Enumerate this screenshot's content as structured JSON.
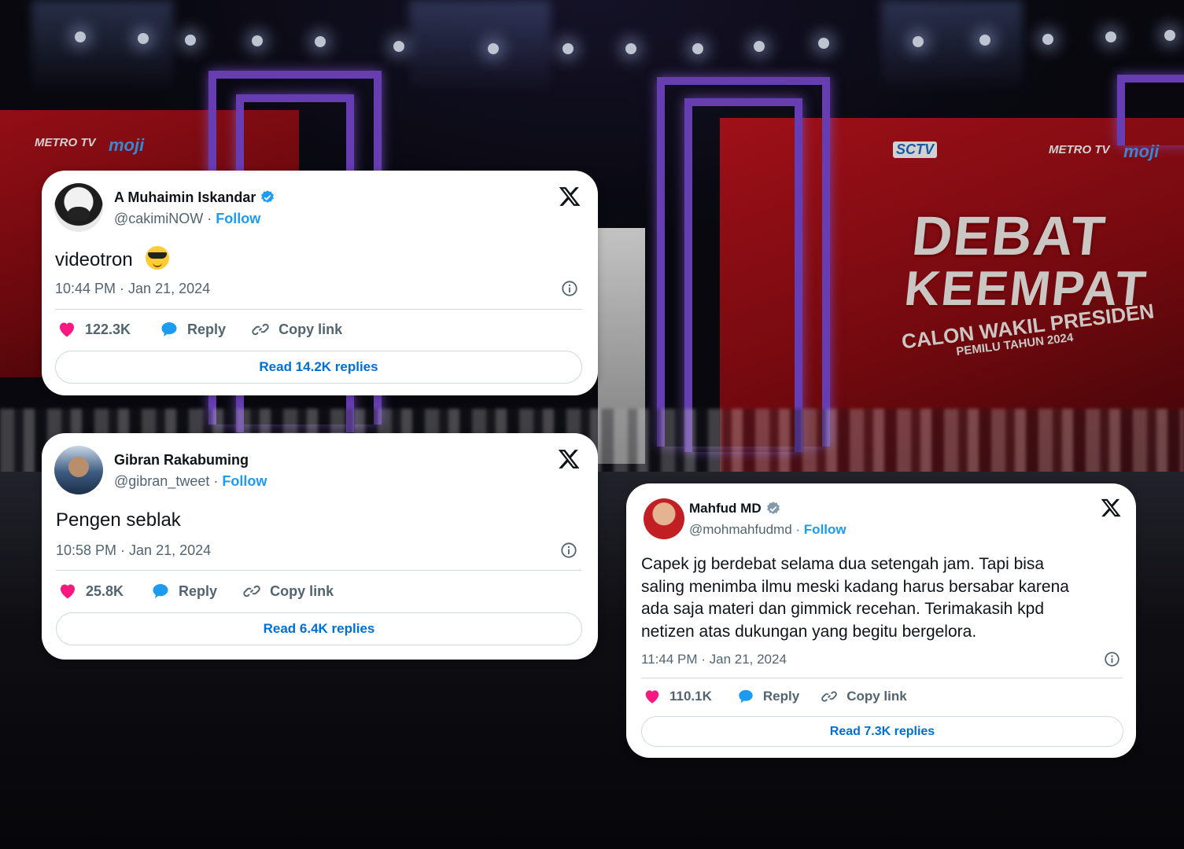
{
  "stage": {
    "debat_line1": "DEBAT",
    "debat_line2": "KEEMPAT",
    "debat_line3": "CALON WAKIL PRESIDEN",
    "debat_line4": "PEMILU TAHUN 2024",
    "brand_sctv": "SCTV",
    "brand_metro": "METRO TV",
    "brand_moji": "moji",
    "brand_metro_left": "METRO TV",
    "brand_moji_left": "moji"
  },
  "tweets": [
    {
      "name": "A Muhaimin Iskandar",
      "verified": true,
      "verified_color": "#1d9bf0",
      "handle": "@cakimiNOW",
      "separator": "·",
      "follow": "Follow",
      "text": "videotron",
      "emoji": "smiling-face-with-sunglasses",
      "time": "10:44 PM · Jan 21, 2024",
      "likes": "122.3K",
      "reply": "Reply",
      "copy_link": "Copy link",
      "read_replies": "Read 14.2K replies"
    },
    {
      "name": "Gibran Rakabuming",
      "verified": false,
      "handle": "@gibran_tweet",
      "separator": "·",
      "follow": "Follow",
      "text": "Pengen seblak",
      "time": "10:58 PM · Jan 21, 2024",
      "likes": "25.8K",
      "reply": "Reply",
      "copy_link": "Copy link",
      "read_replies": "Read 6.4K replies"
    },
    {
      "name": "Mahfud MD",
      "verified": true,
      "verified_color": "#829aab",
      "handle": "@mohmahfudmd",
      "separator": "·",
      "follow": "Follow",
      "text_lines": [
        "Capek jg berdebat selama dua setengah jam. Tapi bisa",
        "saling menimba ilmu meski kadang harus bersabar karena",
        "ada saja materi dan gimmick recehan. Terimakasih kpd",
        "netizen atas dukungan yang begitu bergelora."
      ],
      "time": "11:44 PM · Jan 21, 2024",
      "likes": "110.1K",
      "reply": "Reply",
      "copy_link": "Copy link",
      "read_replies": "Read 7.3K replies"
    }
  ],
  "colors": {
    "like": "#f91880",
    "reply": "#1d9bf0",
    "follow": "#1d9bf0",
    "replies_button_text": "#006fd6",
    "stage_red": "#c3141e",
    "stage_purple": "#7d4bd9"
  }
}
